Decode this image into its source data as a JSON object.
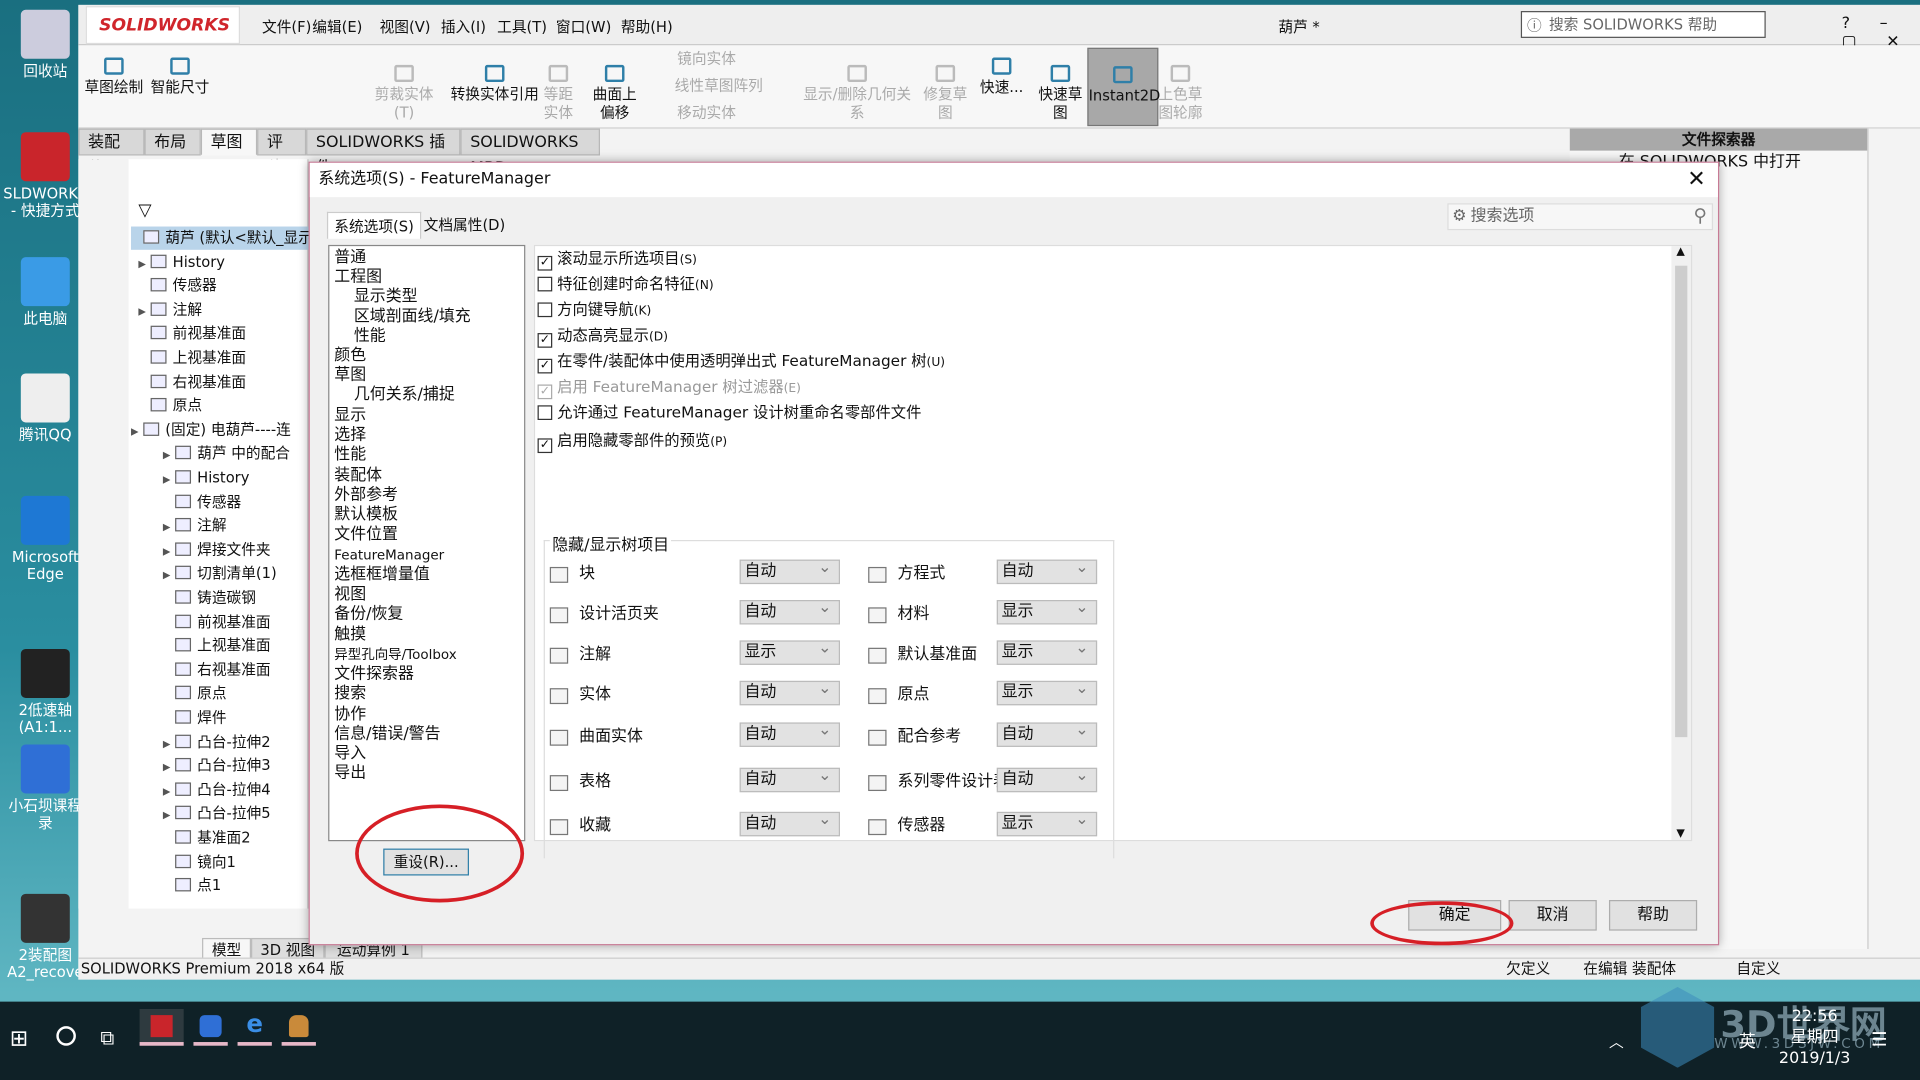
{
  "desktop": {
    "icons": [
      {
        "label": "回收站"
      },
      {
        "label": "SLDWORKS - 快捷方式"
      },
      {
        "label": "此电脑"
      },
      {
        "label": "腾讯QQ"
      },
      {
        "label": "Microsoft Edge"
      },
      {
        "label": "2低速轴 (A1:1..."
      },
      {
        "label": "小石坝课程录"
      },
      {
        "label": "2装配图A2_recove"
      }
    ]
  },
  "app": {
    "logo": "SOLIDWORKS",
    "document_title": "葫芦 *",
    "help_search_placeholder": "搜索 SOLIDWORKS 帮助",
    "menu": [
      "文件(F)",
      "编辑(E)",
      "视图(V)",
      "插入(I)",
      "工具(T)",
      "窗口(W)",
      "帮助(H)"
    ],
    "ribbon": [
      {
        "label": "草图绘制",
        "enabled": true
      },
      {
        "label": "智能尺寸",
        "enabled": true
      },
      {
        "label": "剪裁实体(T)",
        "enabled": false
      },
      {
        "label": "转换实体引用",
        "enabled": true
      },
      {
        "label": "等距实体",
        "enabled": false
      },
      {
        "label": "曲面上偏移",
        "enabled": true
      },
      {
        "label": "镜向实体",
        "enabled": false
      },
      {
        "label": "线性草图阵列",
        "enabled": false
      },
      {
        "label": "移动实体",
        "enabled": false
      },
      {
        "label": "显示/删除几何关系",
        "enabled": false
      },
      {
        "label": "修复草图",
        "enabled": false
      },
      {
        "label": "快速...",
        "enabled": true
      },
      {
        "label": "快速草图",
        "enabled": true
      },
      {
        "label": "Instant2D",
        "enabled": true,
        "active": true
      },
      {
        "label": "上色草图轮廓",
        "enabled": false
      }
    ],
    "tabs": [
      "装配体",
      "布局",
      "草图",
      "评估",
      "SOLIDWORKS 插件",
      "SOLIDWORKS MBD"
    ],
    "active_tab": "草图",
    "tree": [
      {
        "label": "葫芦 (默认<默认_显示",
        "level": 0
      },
      {
        "label": "History",
        "level": 1,
        "exp": true
      },
      {
        "label": "传感器",
        "level": 1
      },
      {
        "label": "注解",
        "level": 1,
        "exp": true
      },
      {
        "label": "前视基准面",
        "level": 1
      },
      {
        "label": "上视基准面",
        "level": 1
      },
      {
        "label": "右视基准面",
        "level": 1
      },
      {
        "label": "原点",
        "level": 1
      },
      {
        "label": "(固定) 电葫芦----连",
        "level": 0,
        "exp": true
      },
      {
        "label": "葫芦 中的配合",
        "level": 2,
        "exp": true
      },
      {
        "label": "History",
        "level": 2,
        "exp": true
      },
      {
        "label": "传感器",
        "level": 2
      },
      {
        "label": "注解",
        "level": 2,
        "exp": true
      },
      {
        "label": "焊接文件夹",
        "level": 2,
        "exp": true
      },
      {
        "label": "切割清单(1)",
        "level": 2,
        "exp": true
      },
      {
        "label": "铸造碳钢",
        "level": 2
      },
      {
        "label": "前视基准面",
        "level": 2
      },
      {
        "label": "上视基准面",
        "level": 2
      },
      {
        "label": "右视基准面",
        "level": 2
      },
      {
        "label": "原点",
        "level": 2
      },
      {
        "label": "焊件",
        "level": 2
      },
      {
        "label": "凸台-拉伸2",
        "level": 2,
        "exp": true
      },
      {
        "label": "凸台-拉伸3",
        "level": 2,
        "exp": true
      },
      {
        "label": "凸台-拉伸4",
        "level": 2,
        "exp": true
      },
      {
        "label": "凸台-拉伸5",
        "level": 2,
        "exp": true
      },
      {
        "label": "基准面2",
        "level": 2
      },
      {
        "label": "镜向1",
        "level": 2
      },
      {
        "label": "点1",
        "level": 2
      }
    ],
    "bottom_tabs": [
      "模型",
      "3D 视图",
      "运动算例 1"
    ],
    "file_explorer": {
      "title": "文件探索器",
      "item": "在 SOLIDWORKS 中打开"
    },
    "status": {
      "version": "SOLIDWORKS Premium 2018 x64 版",
      "state": "欠定义",
      "mode": "在编辑 装配体",
      "units": "自定义"
    }
  },
  "dialog": {
    "title": "系统选项(S) - FeatureManager",
    "tabs": [
      "系统选项(S)",
      "文档属性(D)"
    ],
    "search_placeholder": "搜索选项",
    "categories": [
      {
        "label": "普通"
      },
      {
        "label": "工程图"
      },
      {
        "label": "显示类型",
        "sub": true
      },
      {
        "label": "区域剖面线/填充",
        "sub": true
      },
      {
        "label": "性能",
        "sub": true
      },
      {
        "label": "颜色"
      },
      {
        "label": "草图"
      },
      {
        "label": "几何关系/捕捉",
        "sub": true
      },
      {
        "label": "显示"
      },
      {
        "label": "选择"
      },
      {
        "label": "性能"
      },
      {
        "label": "装配体"
      },
      {
        "label": "外部参考"
      },
      {
        "label": "默认模板"
      },
      {
        "label": "文件位置"
      },
      {
        "label": "FeatureManager",
        "selected": true
      },
      {
        "label": "选框框增量值"
      },
      {
        "label": "视图"
      },
      {
        "label": "备份/恢复"
      },
      {
        "label": "触摸"
      },
      {
        "label": "异型孔向导/Toolbox"
      },
      {
        "label": "文件探索器"
      },
      {
        "label": "搜索"
      },
      {
        "label": "协作"
      },
      {
        "label": "信息/错误/警告"
      },
      {
        "label": "导入"
      },
      {
        "label": "导出"
      }
    ],
    "options": [
      {
        "label": "滚动显示所选项目",
        "key": "(S)",
        "checked": true
      },
      {
        "label": "特征创建时命名特征",
        "key": "(N)",
        "checked": false
      },
      {
        "label": "方向键导航",
        "key": "(K)",
        "checked": false
      },
      {
        "label": "动态高亮显示",
        "key": "(D)",
        "checked": true
      },
      {
        "label": "在零件/装配体中使用透明弹出式 FeatureManager 树",
        "key": "(U)",
        "checked": true
      },
      {
        "label": "启用 FeatureManager 树过滤器",
        "key": "(E)",
        "checked": true,
        "disabled": true
      },
      {
        "label": "允许通过 FeatureManager 设计树重命名零部件文件",
        "key": "",
        "checked": false
      },
      {
        "label": "启用隐藏零部件的预览",
        "key": "(P)",
        "checked": true
      }
    ],
    "group_title": "隐藏/显示树项目",
    "left_items": [
      {
        "label": "块",
        "value": "自动"
      },
      {
        "label": "设计活页夹",
        "value": "自动"
      },
      {
        "label": "注解",
        "value": "显示"
      },
      {
        "label": "实体",
        "value": "自动"
      },
      {
        "label": "曲面实体",
        "value": "自动"
      },
      {
        "label": "表格",
        "value": "自动"
      },
      {
        "label": "收藏",
        "value": "自动"
      }
    ],
    "right_items": [
      {
        "label": "方程式",
        "value": "自动"
      },
      {
        "label": "材料",
        "value": "显示"
      },
      {
        "label": "默认基准面",
        "value": "显示"
      },
      {
        "label": "原点",
        "value": "显示"
      },
      {
        "label": "配合参考",
        "value": "自动"
      },
      {
        "label": "系列零件设计表",
        "value": "自动"
      },
      {
        "label": "传感器",
        "value": "显示"
      }
    ],
    "reset": "重设(R)...",
    "ok": "确定",
    "cancel": "取消",
    "help": "帮助"
  },
  "taskbar": {
    "time": "22:56",
    "weekday": "星期四",
    "date": "2019/1/3",
    "ime": "英",
    "watermark": "3D世界网",
    "watermark_url": "WWW.3DSJW.COM"
  },
  "colors": {
    "annotation": "#d61f26",
    "accent": "#2f7fa8"
  }
}
